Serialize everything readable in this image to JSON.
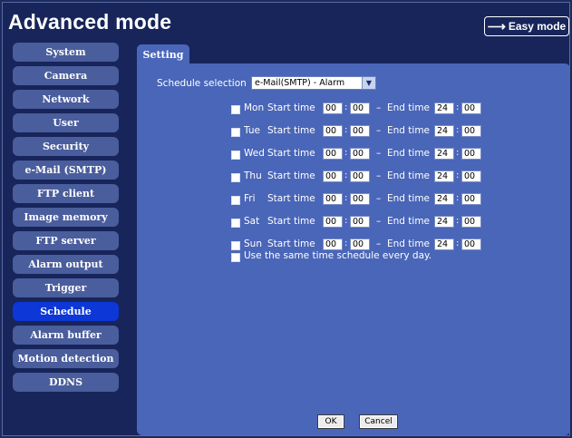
{
  "header": {
    "title": "Advanced mode",
    "easy_mode_label": "Easy mode",
    "easy_mode_icon": "arrow-right-icon"
  },
  "sidebar": {
    "items": [
      {
        "label": "System"
      },
      {
        "label": "Camera"
      },
      {
        "label": "Network"
      },
      {
        "label": "User"
      },
      {
        "label": "Security"
      },
      {
        "label": "e-Mail (SMTP)"
      },
      {
        "label": "FTP client"
      },
      {
        "label": "Image memory"
      },
      {
        "label": "FTP server"
      },
      {
        "label": "Alarm output"
      },
      {
        "label": "Trigger"
      },
      {
        "label": "Schedule"
      },
      {
        "label": "Alarm buffer"
      },
      {
        "label": "Motion detection"
      },
      {
        "label": "DDNS"
      }
    ],
    "active": "Schedule"
  },
  "tab": {
    "label": "Setting"
  },
  "schedule": {
    "label": "Schedule selection",
    "selected": "e-Mail(SMTP) - Alarm"
  },
  "labels": {
    "start": "Start time",
    "end": "End time",
    "dash": "–",
    "colon": ":"
  },
  "days": [
    {
      "name": "Mon",
      "start_h": "00",
      "start_m": "00",
      "end_h": "24",
      "end_m": "00"
    },
    {
      "name": "Tue",
      "start_h": "00",
      "start_m": "00",
      "end_h": "24",
      "end_m": "00"
    },
    {
      "name": "Wed",
      "start_h": "00",
      "start_m": "00",
      "end_h": "24",
      "end_m": "00"
    },
    {
      "name": "Thu",
      "start_h": "00",
      "start_m": "00",
      "end_h": "24",
      "end_m": "00"
    },
    {
      "name": "Fri",
      "start_h": "00",
      "start_m": "00",
      "end_h": "24",
      "end_m": "00"
    },
    {
      "name": "Sat",
      "start_h": "00",
      "start_m": "00",
      "end_h": "24",
      "end_m": "00"
    },
    {
      "name": "Sun",
      "start_h": "00",
      "start_m": "00",
      "end_h": "24",
      "end_m": "00"
    }
  ],
  "same_schedule_label": "Use the same time schedule every day.",
  "buttons": {
    "ok": "OK",
    "cancel": "Cancel"
  },
  "colors": {
    "background": "#17255a",
    "sidebar_item": "#4a5d9c",
    "sidebar_active": "#0d37d6",
    "panel": "#4a66b8"
  }
}
